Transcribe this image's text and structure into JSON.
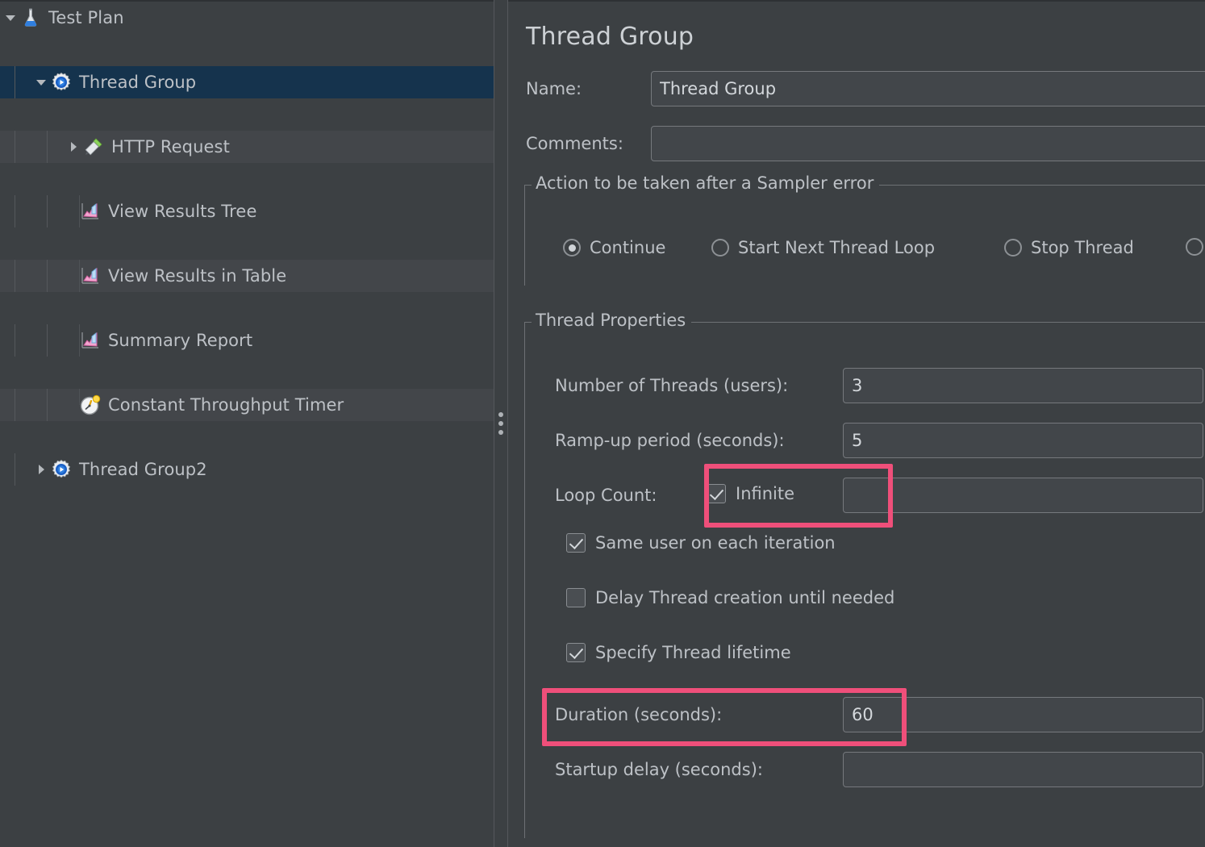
{
  "tree": {
    "name": "test-plan-tree",
    "items": [
      {
        "label": "Test Plan",
        "icon": "flask-icon",
        "indent": 0,
        "twisty": "expanded",
        "selected": false
      },
      {
        "label": "Thread Group",
        "icon": "gear-icon",
        "indent": 1,
        "twisty": "expanded",
        "selected": true
      },
      {
        "label": "HTTP Request",
        "icon": "pipette-icon",
        "indent": 2,
        "twisty": "collapsed",
        "selected": false
      },
      {
        "label": "View Results Tree",
        "icon": "chart-icon",
        "indent": 2,
        "twisty": "none",
        "selected": false
      },
      {
        "label": "View Results in Table",
        "icon": "chart-icon",
        "indent": 2,
        "twisty": "none",
        "selected": false
      },
      {
        "label": "Summary Report",
        "icon": "chart-icon",
        "indent": 2,
        "twisty": "none",
        "selected": false
      },
      {
        "label": "Constant Throughput Timer",
        "icon": "clock-icon",
        "indent": 2,
        "twisty": "none",
        "selected": false
      },
      {
        "label": "Thread Group2",
        "icon": "gear-icon",
        "indent": 1,
        "twisty": "collapsed",
        "selected": false
      }
    ]
  },
  "splitter": {
    "name": "panel-splitter"
  },
  "detail": {
    "title": "Thread Group",
    "name_label": "Name:",
    "name_value": "Thread Group",
    "comments_label": "Comments:",
    "comments_value": "",
    "comments_placeholder": "",
    "sampler_error_group": "Action to be taken after a Sampler error",
    "sampler_error_options": [
      {
        "label": "Continue",
        "checked": true
      },
      {
        "label": "Start Next Thread Loop",
        "checked": false
      },
      {
        "label": "Stop Thread",
        "checked": false
      },
      {
        "label": "",
        "checked": false
      }
    ],
    "thread_properties_group": "Thread Properties",
    "num_threads_label": "Number of Threads (users):",
    "num_threads_value": "3",
    "rampup_label": "Ramp-up period (seconds):",
    "rampup_value": "5",
    "loop_count_label": "Loop Count:",
    "loop_infinite_label": "Infinite",
    "loop_infinite_checked": true,
    "loop_count_value": "",
    "same_user_label": "Same user on each iteration",
    "same_user_checked": true,
    "delay_thread_label": "Delay Thread creation until needed",
    "delay_thread_checked": false,
    "specify_lifetime_label": "Specify Thread lifetime",
    "specify_lifetime_checked": true,
    "duration_label": "Duration (seconds):",
    "duration_value": "60",
    "startup_delay_label": "Startup delay (seconds):",
    "startup_delay_value": ""
  },
  "annotations": {
    "highlight_color": "#ef4f7a",
    "boxes": [
      {
        "name": "infinite-checkbox-highlight"
      },
      {
        "name": "duration-field-highlight"
      }
    ]
  }
}
